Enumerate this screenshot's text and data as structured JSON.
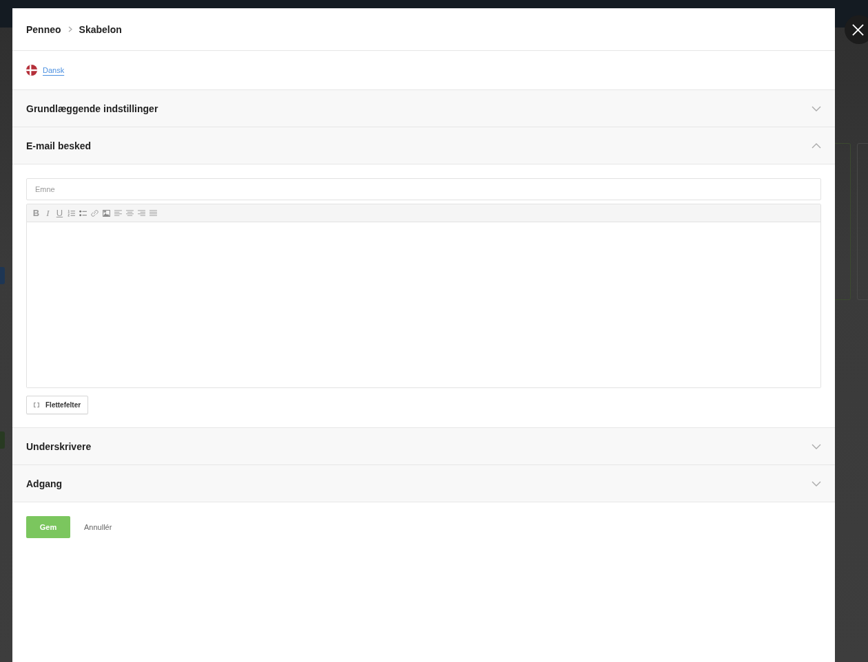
{
  "breadcrumb": [
    {
      "label": "Penneo"
    },
    {
      "label": "Skabelon"
    }
  ],
  "language": {
    "label": "Dansk"
  },
  "sections": [
    {
      "title": "Grundlæggende indstillinger",
      "expanded": false
    },
    {
      "title": "E-mail besked",
      "expanded": true,
      "form": {
        "subject": {
          "placeholder": "Emne"
        },
        "toolbar": [
          {
            "kind": "bold",
            "glyph": "B"
          },
          {
            "kind": "italic",
            "glyph": "I"
          },
          {
            "kind": "underline",
            "glyph": "U"
          },
          {
            "kind": "ordered-list"
          },
          {
            "kind": "bullet-list"
          },
          {
            "kind": "link"
          },
          {
            "kind": "image"
          },
          {
            "kind": "align-left"
          },
          {
            "kind": "align-center"
          },
          {
            "kind": "align-right"
          },
          {
            "kind": "justify"
          }
        ],
        "merge_fields_button": {
          "label": "Flettefelter"
        }
      }
    },
    {
      "title": "Underskrivere",
      "expanded": false
    },
    {
      "title": "Adgang",
      "expanded": false
    }
  ],
  "actions": {
    "save": "Gem",
    "cancel": "Annullér"
  }
}
